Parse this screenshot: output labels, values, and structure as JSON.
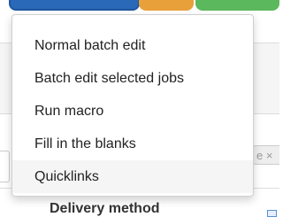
{
  "background": {
    "tag_text": "e ×",
    "footer_text": "Delivery method"
  },
  "menu": {
    "items": [
      {
        "label": "Normal batch edit"
      },
      {
        "label": "Batch edit selected jobs"
      },
      {
        "label": "Run macro"
      },
      {
        "label": "Fill in the blanks"
      },
      {
        "label": "Quicklinks"
      }
    ],
    "highlighted_index": 4
  },
  "colors": {
    "primary_button": "#2a69b8",
    "warning_button": "#e8a03a",
    "success_button": "#5cb85c"
  }
}
